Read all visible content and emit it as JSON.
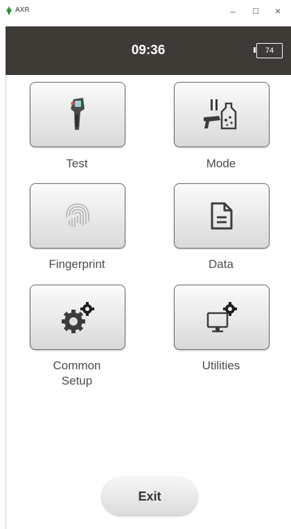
{
  "window": {
    "app_name": "AXR",
    "minimize": "–",
    "maximize": "☐",
    "close": "×"
  },
  "header": {
    "time": "09:36",
    "battery": "74"
  },
  "tiles": [
    {
      "label": "Test",
      "icon": "handheld-analyzer-icon"
    },
    {
      "label": "Mode",
      "icon": "spray-bottle-icon"
    },
    {
      "label": "Fingerprint",
      "icon": "fingerprint-icon"
    },
    {
      "label": "Data",
      "icon": "document-icon"
    },
    {
      "label": "Common\nSetup",
      "icon": "gears-icon"
    },
    {
      "label": "Utilities",
      "icon": "monitor-gear-icon"
    }
  ],
  "exit_label": "Exit",
  "colors": {
    "header_bg": "#3e3a36",
    "tile_border": "#6a6a6a",
    "icon_color": "#3c3c3c",
    "label_color": "#4a4a4a"
  }
}
